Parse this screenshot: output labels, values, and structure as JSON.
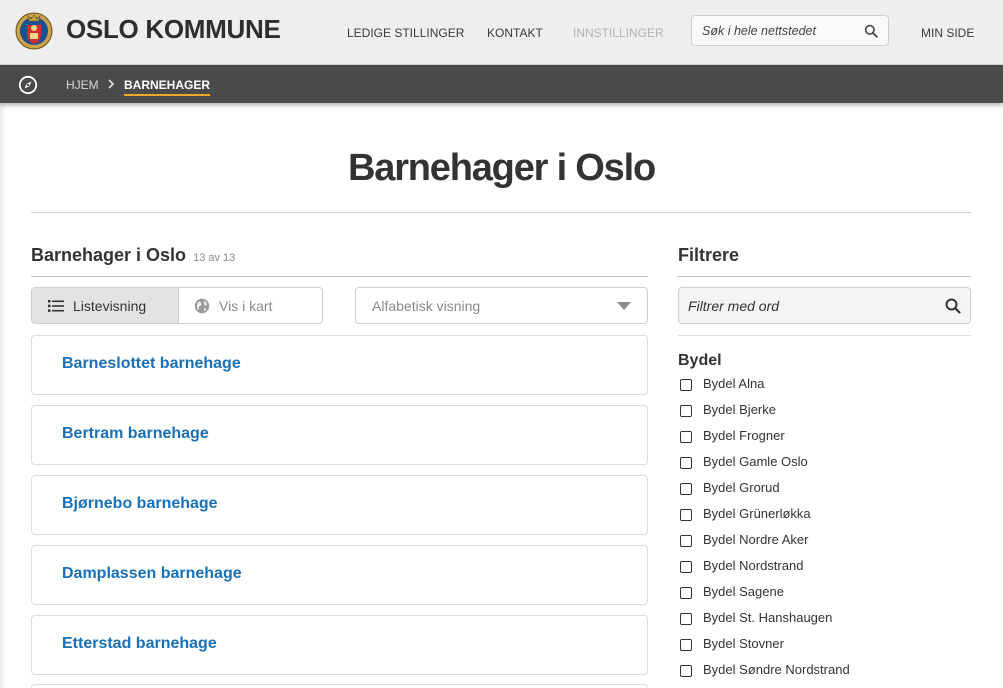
{
  "header": {
    "brand": "OSLO KOMMUNE",
    "nav": [
      {
        "label": "LEDIGE STILLINGER"
      },
      {
        "label": "KONTAKT"
      },
      {
        "label": "INNSTILLINGER"
      }
    ],
    "search_placeholder": "Søk i hele nettstedet",
    "my_page": "MIN SIDE"
  },
  "breadcrumb": {
    "home": "HJEM",
    "current": "BARNEHAGER"
  },
  "page_title": "Barnehager i Oslo",
  "list": {
    "heading": "Barnehager i Oslo",
    "count": "13 av 13",
    "view_list_label": "Listevisning",
    "view_map_label": "Vis i kart",
    "sort_label": "Alfabetisk visning",
    "items": [
      {
        "name": "Barneslottet barnehage"
      },
      {
        "name": "Bertram barnehage"
      },
      {
        "name": "Bjørnebo barnehage"
      },
      {
        "name": "Damplassen barnehage"
      },
      {
        "name": "Etterstad barnehage"
      }
    ]
  },
  "filter": {
    "heading": "Filtrere",
    "placeholder": "Filtrer med ord",
    "bydel_heading": "Bydel",
    "bydeler": [
      {
        "label": "Bydel Alna"
      },
      {
        "label": "Bydel Bjerke"
      },
      {
        "label": "Bydel Frogner"
      },
      {
        "label": "Bydel Gamle Oslo"
      },
      {
        "label": "Bydel Grorud"
      },
      {
        "label": "Bydel Grünerløkka"
      },
      {
        "label": "Bydel Nordre Aker"
      },
      {
        "label": "Bydel Nordstrand"
      },
      {
        "label": "Bydel Sagene"
      },
      {
        "label": "Bydel St. Hanshaugen"
      },
      {
        "label": "Bydel Stovner"
      },
      {
        "label": "Bydel Søndre Nordstrand"
      }
    ]
  },
  "colors": {
    "link": "#1a70b8",
    "breadcrumb_bg": "#4a4a4a",
    "breadcrumb_accent": "#f5a623",
    "header_bg": "#eeeeee"
  }
}
